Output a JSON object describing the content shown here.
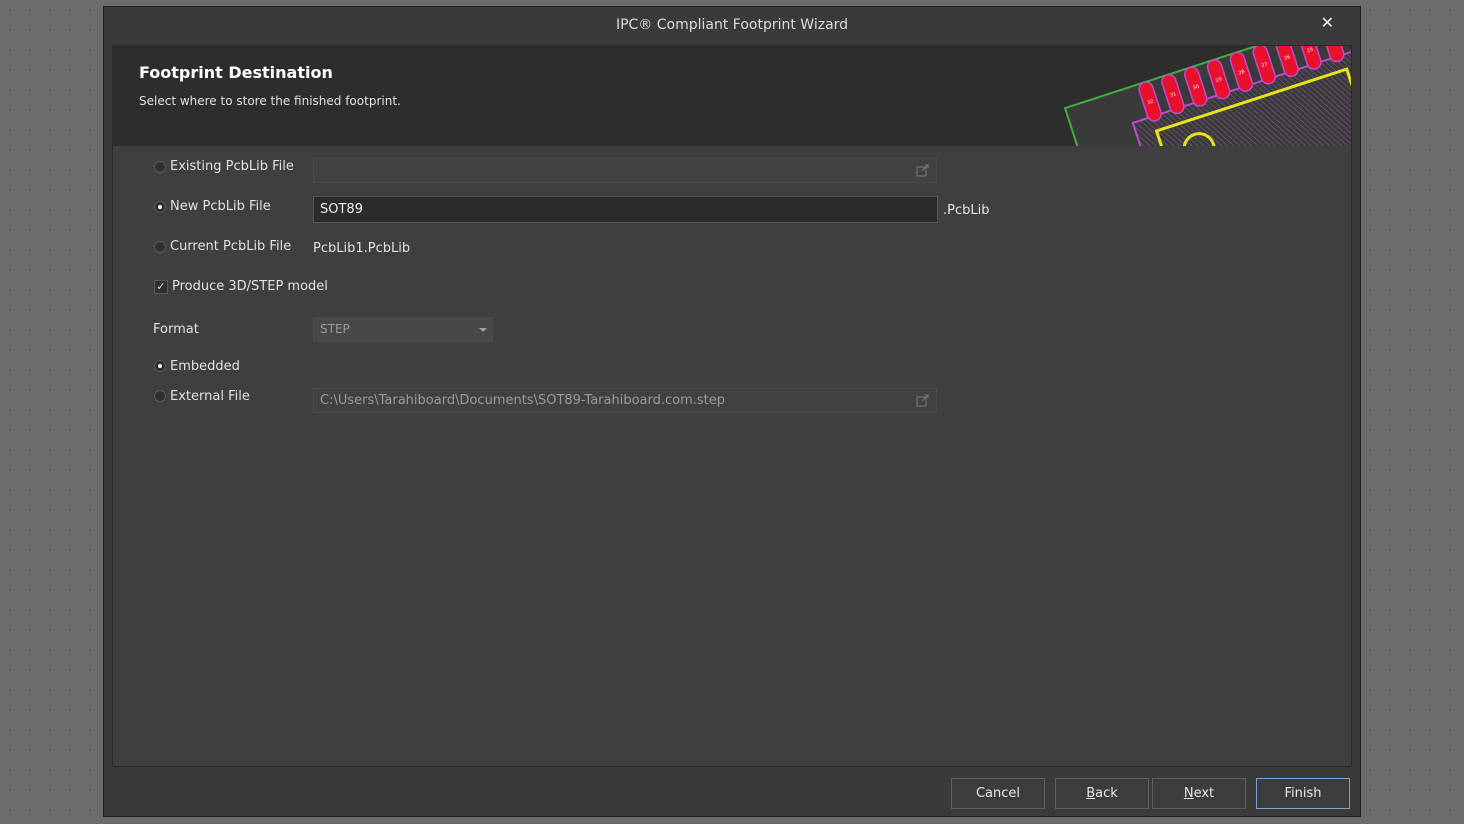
{
  "window": {
    "title": "IPC® Compliant Footprint Wizard"
  },
  "header": {
    "title": "Footprint Destination",
    "subtitle": "Select where to store the finished footprint.",
    "banner_pad_labels": [
      "32",
      "31",
      "30",
      "29",
      "28",
      "27",
      "26",
      "25",
      "1",
      "2"
    ]
  },
  "form": {
    "existing": {
      "label": "Existing PcbLib File",
      "selected": false,
      "value": ""
    },
    "new": {
      "label": "New PcbLib File",
      "selected": true,
      "value": "SOT89",
      "suffix": ".PcbLib"
    },
    "current": {
      "label": "Current PcbLib File",
      "selected": false,
      "value": "PcbLib1.PcbLib"
    },
    "produce_3d": {
      "label": "Produce 3D/STEP model",
      "checked": true
    },
    "format": {
      "label": "Format",
      "value": "STEP"
    },
    "embedded": {
      "label": "Embedded",
      "selected": true
    },
    "external": {
      "label": "External File",
      "selected": false,
      "value": "C:\\Users\\Tarahiboard\\Documents\\SOT89-Tarahiboard.com.step"
    }
  },
  "buttons": {
    "cancel": "Cancel",
    "back_first": "B",
    "back_rest": "ack",
    "next_first": "N",
    "next_rest": "ext",
    "finish": "Finish"
  },
  "colors": {
    "pad": "#e8102a",
    "silkscreen": "#e8e21a",
    "board_outline": "#3fae3f",
    "accent": "#7aa6d6"
  }
}
